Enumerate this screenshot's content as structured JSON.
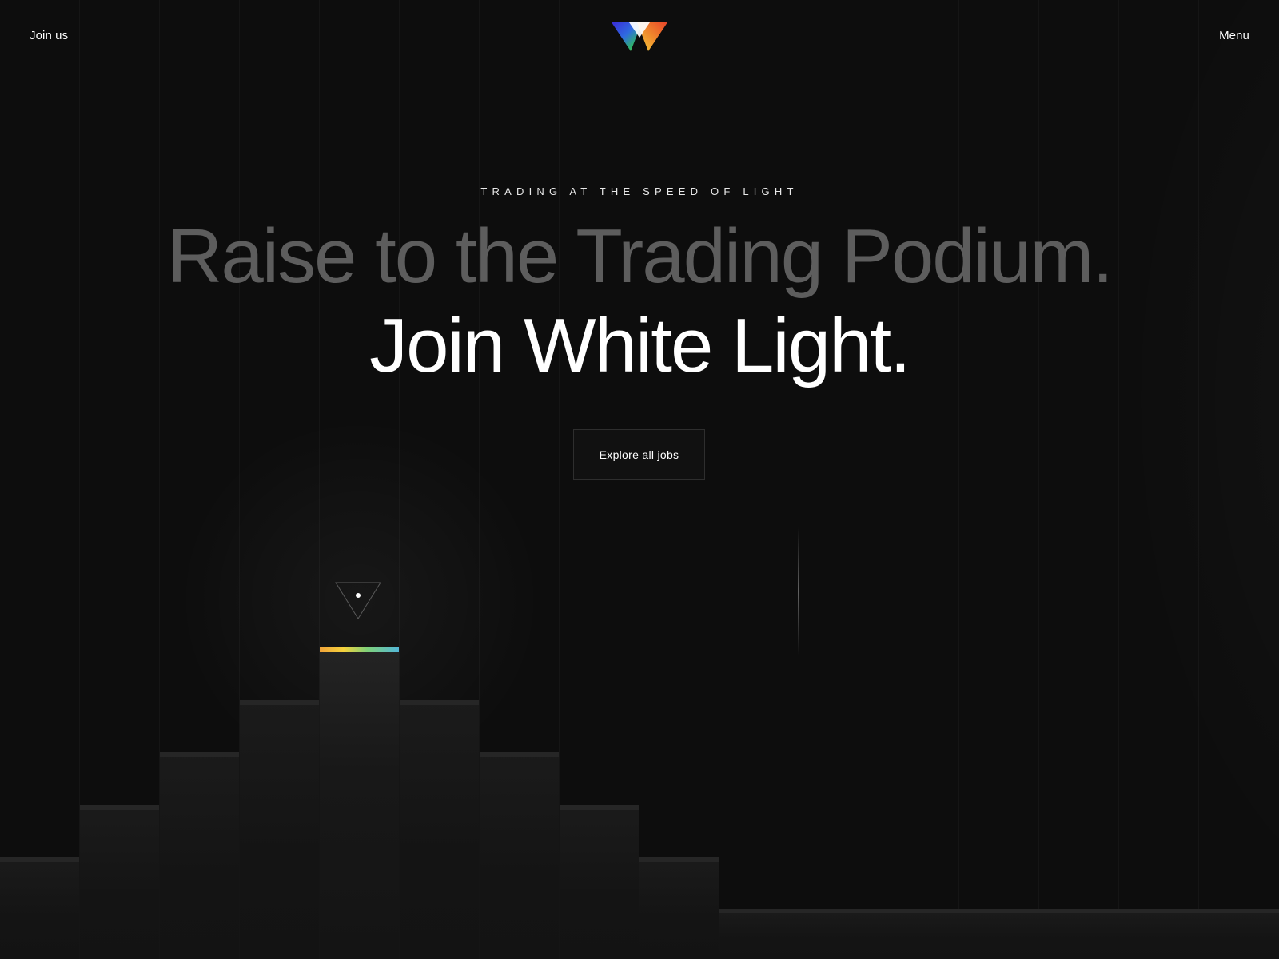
{
  "header": {
    "join_label": "Join us",
    "menu_label": "Menu",
    "logo_icon": "prism-w-logo"
  },
  "hero": {
    "eyebrow": "TRADING AT THE SPEED OF LIGHT",
    "headline_dim": "Raise to the Trading Podium.",
    "headline_bright": "Join White Light.",
    "cta_label": "Explore all jobs"
  },
  "podium": {
    "marker_icon": "triangle-pointer-icon",
    "accent_gradient": [
      "#f0a33a",
      "#f5d23c",
      "#7fd17a",
      "#54b8d8"
    ]
  },
  "colors": {
    "background": "#0d0d0d",
    "headline_dim": "#5d5d5d",
    "headline_bright": "#ffffff"
  }
}
